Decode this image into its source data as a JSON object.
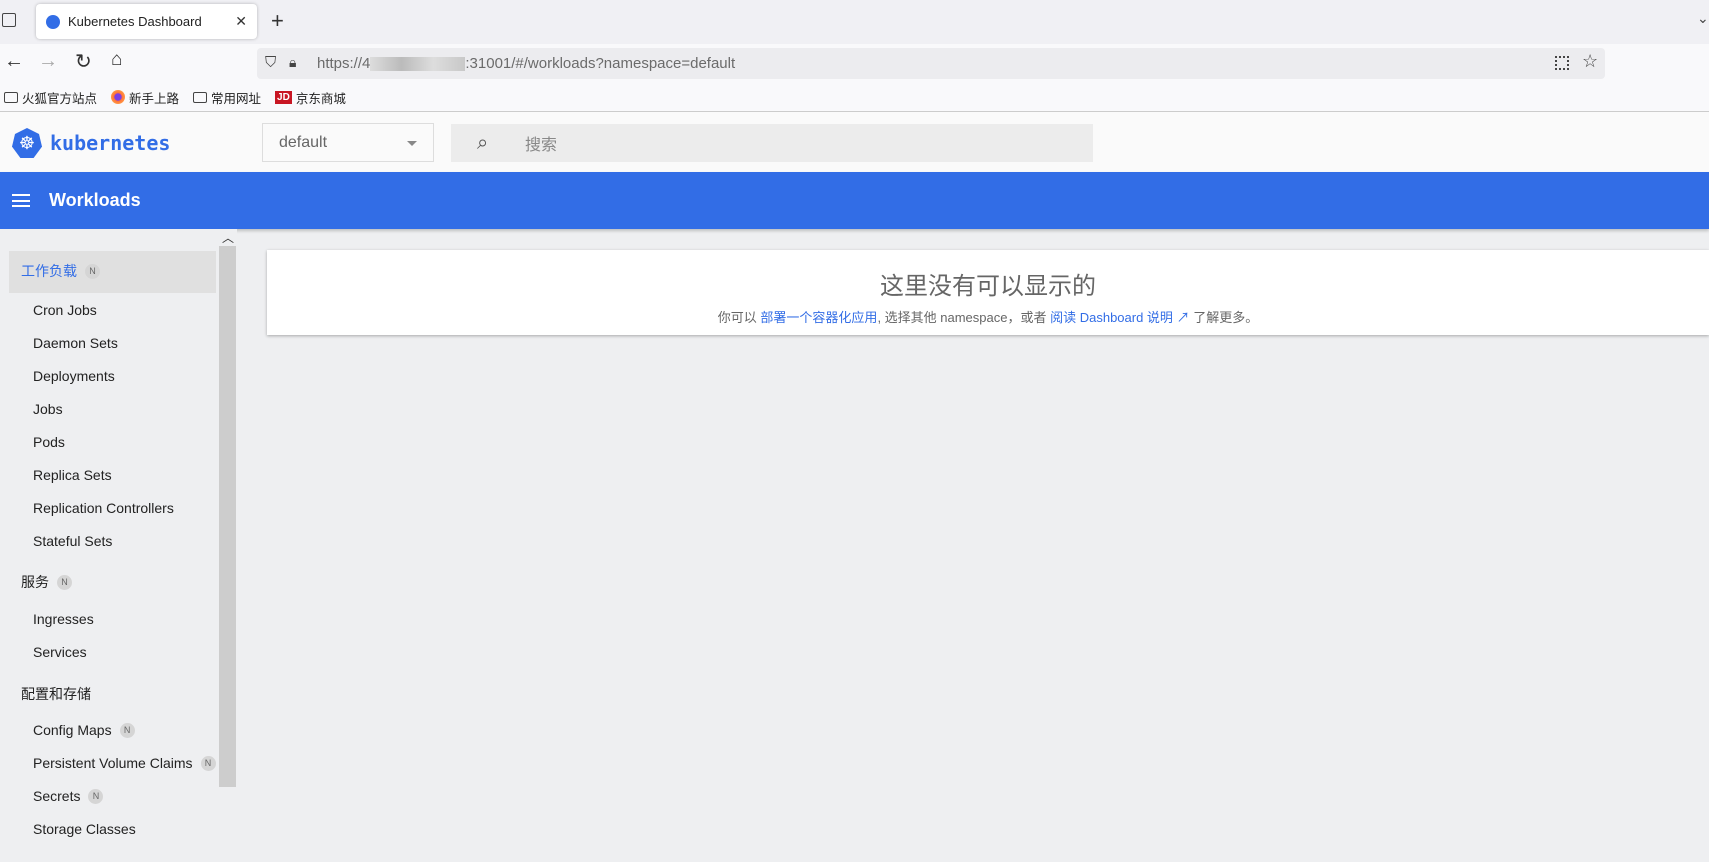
{
  "browser": {
    "tab_title": "Kubernetes Dashboard",
    "url_prefix": "https://4",
    "url_suffix": ":31001/#/workloads?namespace=default",
    "bookmarks": [
      "火狐官方站点",
      "新手上路",
      "常用网址",
      "京东商城"
    ],
    "jd_logo": "JD"
  },
  "header": {
    "logo_text": "kubernetes",
    "namespace": "default",
    "search_placeholder": "搜索"
  },
  "toolbar": {
    "title": "Workloads"
  },
  "sidebar": {
    "badge": "N",
    "workloads": {
      "label": "工作负载",
      "items": [
        "Cron Jobs",
        "Daemon Sets",
        "Deployments",
        "Jobs",
        "Pods",
        "Replica Sets",
        "Replication Controllers",
        "Stateful Sets"
      ]
    },
    "services": {
      "label": "服务",
      "items": [
        "Ingresses",
        "Services"
      ]
    },
    "config": {
      "label": "配置和存储",
      "items": [
        "Config Maps",
        "Persistent Volume Claims",
        "Secrets",
        "Storage Classes"
      ]
    }
  },
  "empty": {
    "title": "这里没有可以显示的",
    "p1": "你可以 ",
    "link1": "部署一个容器化应用",
    "p2": ", 选择其他 namespace，或者 ",
    "link2": "阅读 Dashboard 说明",
    "p3": " 了解更多。"
  },
  "colors": {
    "primary": "#326de6"
  }
}
